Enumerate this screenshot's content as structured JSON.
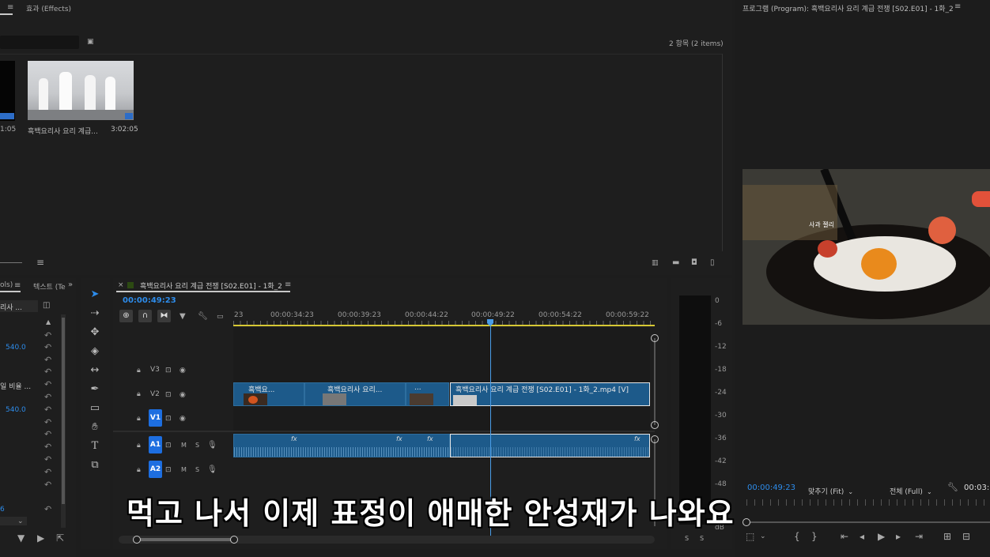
{
  "project": {
    "tab_label": "효과 (Effects)",
    "items_count": "2 항목 (2 items)",
    "clip_name": "흑백요리사 요리 계급...",
    "clip_duration": "3:02:05",
    "left_duration_partial": "1:05"
  },
  "program": {
    "title": "프로그램 (Program): 흑백요리사 요리 계급 전쟁 [S02.E01] - 1화_2",
    "timecode": "00:00:49:23",
    "fit_label": "맞추기 (Fit)",
    "quality_label": "전체 (Full)",
    "duration_partial": "00:03:",
    "image_label": "사과 젤리"
  },
  "effect_controls": {
    "tab1_partial": "ols)",
    "tab2_partial": "텍스트 (Te",
    "row1": "리사 ...",
    "value1": "540.0",
    "row2": "일 비율 ...",
    "value2": "540.0",
    "value3_partial": "6"
  },
  "timeline": {
    "tab_title": "흑백요리사 요리 계급 전쟁 [S02.E01] - 1화_2",
    "timecode": "00:00:49:23",
    "ruler": [
      "23",
      "00:00:34:23",
      "00:00:39:23",
      "00:00:44:22",
      "00:00:49:22",
      "00:00:54:22",
      "00:00:59:22"
    ],
    "tracks": [
      {
        "name": "V3"
      },
      {
        "name": "V2"
      },
      {
        "name": "V1"
      },
      {
        "name": "A1"
      },
      {
        "name": "A2"
      }
    ],
    "clips": {
      "v2_a": "흑백요...",
      "v2_b": "흑백요리사 요리...",
      "v2_c": "...",
      "v2_d": "흑백요리사 요리 계급 전쟁 [S02.E01] - 1화_2.mp4 [V]"
    },
    "fx": "fx",
    "m": "M",
    "s": "S"
  },
  "meter": {
    "scale": [
      "0",
      "-6",
      "-12",
      "-18",
      "-24",
      "-30",
      "-36",
      "-42",
      "-48"
    ],
    "db": "dB",
    "s": "S"
  },
  "subtitle": "먹고 나서 이제 표정이 애매한 안성재가 나와요",
  "colors": {
    "accent": "#2d8ceb",
    "clip": "#1d5a8a",
    "trackbtn": "#1d6ee0",
    "playhead": "#4a9de8"
  }
}
